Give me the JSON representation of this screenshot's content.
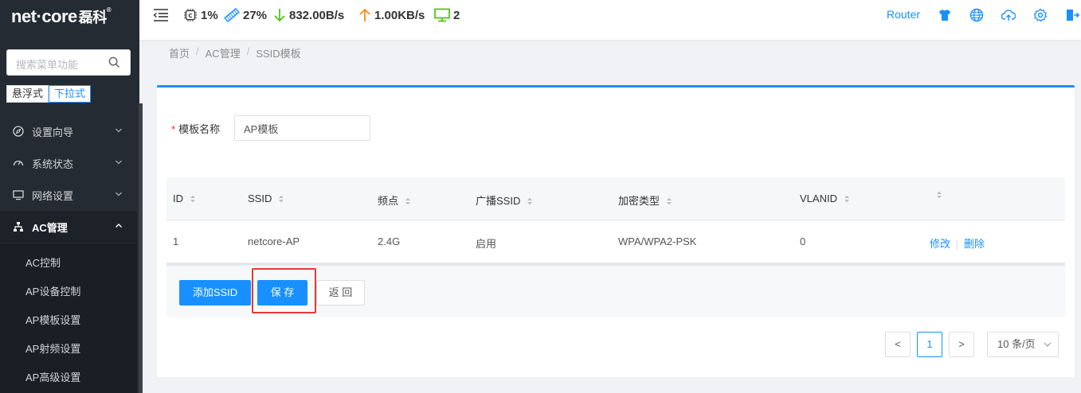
{
  "sidebar": {
    "logo_text": "net·core",
    "logo_cn": "磊科",
    "logo_reg": "®",
    "search_placeholder": "搜索菜单功能",
    "mode_tabs": [
      "悬浮式",
      "下拉式"
    ],
    "menu": [
      {
        "label": "设置向导",
        "icon": "compass-icon"
      },
      {
        "label": "系统状态",
        "icon": "dashboard-icon"
      },
      {
        "label": "网络设置",
        "icon": "monitor-icon"
      },
      {
        "label": "AC管理",
        "icon": "sitemap-icon"
      }
    ],
    "submenu": [
      "AC控制",
      "AP设备控制",
      "AP模板设置",
      "AP射频设置",
      "AP高级设置"
    ]
  },
  "topbar": {
    "cpu": "1%",
    "memory": "27%",
    "download": "832.00B/s",
    "upload": "1.00KB/s",
    "devices": "2",
    "router_label": "Router"
  },
  "breadcrumb": [
    "首页",
    "AC管理",
    "SSID模板"
  ],
  "form": {
    "template_name_label": "模板名称",
    "template_name_value": "AP模板"
  },
  "table": {
    "headers": [
      "ID",
      "SSID",
      "频点",
      "广播SSID",
      "加密类型",
      "VLANID"
    ],
    "rows": [
      {
        "id": "1",
        "ssid": "netcore-AP",
        "band": "2.4G",
        "broadcast": "启用",
        "encryption": "WPA/WPA2-PSK",
        "vlanid": "0",
        "edit": "修改",
        "delete": "删除"
      }
    ]
  },
  "actions": {
    "add_ssid": "添加SSID",
    "save": "保 存",
    "back": "返 回"
  },
  "pagination": {
    "prev": "<",
    "current": "1",
    "next": ">",
    "page_size": "10 条/页"
  },
  "colors": {
    "accent": "#1890ff",
    "sidebar_bg": "#252b33",
    "highlight": "#e53935",
    "download_arrow": "#52c41a",
    "upload_arrow": "#fa8c16"
  }
}
